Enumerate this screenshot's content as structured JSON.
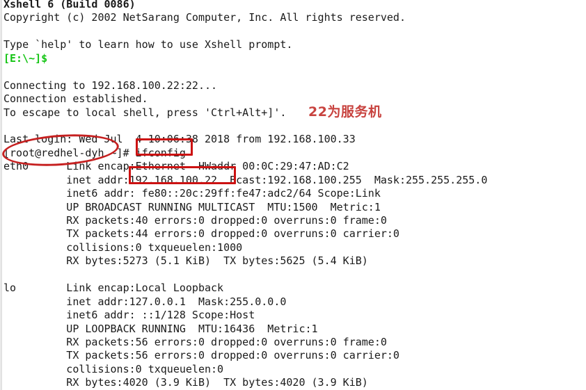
{
  "window": {
    "app_name": "Xshell",
    "title_line": "Xshell 6 (Build 0086)"
  },
  "colors": {
    "background": "#ffffff",
    "foreground": "#1a1a1a",
    "prompt_green": "#14c414",
    "annotation_red": "#cc1212",
    "ellipse_red": "#c62020",
    "note_red": "#c8433f"
  },
  "terminal": {
    "lines": [
      {
        "text": "Xshell 6 (Build 0086)",
        "style": "bold"
      },
      {
        "text": "Copyright (c) 2002 NetSarang Computer, Inc. All rights reserved.",
        "style": "normal"
      },
      {
        "text": "",
        "style": "blank"
      },
      {
        "text": "Type `help' to learn how to use Xshell prompt.",
        "style": "normal"
      },
      {
        "text": "[E:\\~]$",
        "style": "green"
      },
      {
        "text": "",
        "style": "blank"
      },
      {
        "text": "Connecting to 192.168.100.22:22...",
        "style": "normal"
      },
      {
        "text": "Connection established.",
        "style": "normal"
      },
      {
        "text": "To escape to local shell, press 'Ctrl+Alt+]'.",
        "style": "normal"
      },
      {
        "text": "",
        "style": "blank"
      },
      {
        "text": "Last login: Wed Jul  4 10:06:38 2018 from 192.168.100.33",
        "style": "normal"
      },
      {
        "text": "[root@redhel-dyh ~]# ifconfig",
        "style": "normal"
      },
      {
        "text": "eth0      Link encap:Ethernet  HWaddr 00:0C:29:47:AD:C2",
        "style": "normal"
      },
      {
        "text": "          inet addr:192.168.100.22  Bcast:192.168.100.255  Mask:255.255.255.0",
        "style": "normal"
      },
      {
        "text": "          inet6 addr: fe80::20c:29ff:fe47:adc2/64 Scope:Link",
        "style": "normal"
      },
      {
        "text": "          UP BROADCAST RUNNING MULTICAST  MTU:1500  Metric:1",
        "style": "normal"
      },
      {
        "text": "          RX packets:40 errors:0 dropped:0 overruns:0 frame:0",
        "style": "normal"
      },
      {
        "text": "          TX packets:44 errors:0 dropped:0 overruns:0 carrier:0",
        "style": "normal"
      },
      {
        "text": "          collisions:0 txqueuelen:1000",
        "style": "normal"
      },
      {
        "text": "          RX bytes:5273 (5.1 KiB)  TX bytes:5625 (5.4 KiB)",
        "style": "normal"
      },
      {
        "text": "",
        "style": "blank"
      },
      {
        "text": "lo        Link encap:Local Loopback",
        "style": "normal"
      },
      {
        "text": "          inet addr:127.0.0.1  Mask:255.0.0.0",
        "style": "normal"
      },
      {
        "text": "          inet6 addr: ::1/128 Scope:Host",
        "style": "normal"
      },
      {
        "text": "          UP LOOPBACK RUNNING  MTU:16436  Metric:1",
        "style": "normal"
      },
      {
        "text": "          RX packets:56 errors:0 dropped:0 overruns:0 frame:0",
        "style": "normal"
      },
      {
        "text": "          TX packets:56 errors:0 dropped:0 overruns:0 carrier:0",
        "style": "normal"
      },
      {
        "text": "          collisions:0 txqueuelen:0",
        "style": "normal"
      },
      {
        "text": "          RX bytes:4020 (3.9 KiB)  TX bytes:4020 (3.9 KiB)",
        "style": "normal"
      }
    ]
  },
  "session": {
    "host": "192.168.100.22",
    "port": "22",
    "hostname": "redhel-dyh",
    "user": "root",
    "last_login": "Wed Jul  4 10:06:38 2018 from 192.168.100.33",
    "local_prompt": "[E:\\~]$",
    "remote_prompt": "[root@redhel-dyh ~]#",
    "command": "ifconfig"
  },
  "annotations": {
    "note_text": "22为服务机",
    "highlight_command": "ifconfig",
    "highlight_ip": "192.168.100.22",
    "circled_prompt": "[root@redhel-dyh ~]#"
  }
}
